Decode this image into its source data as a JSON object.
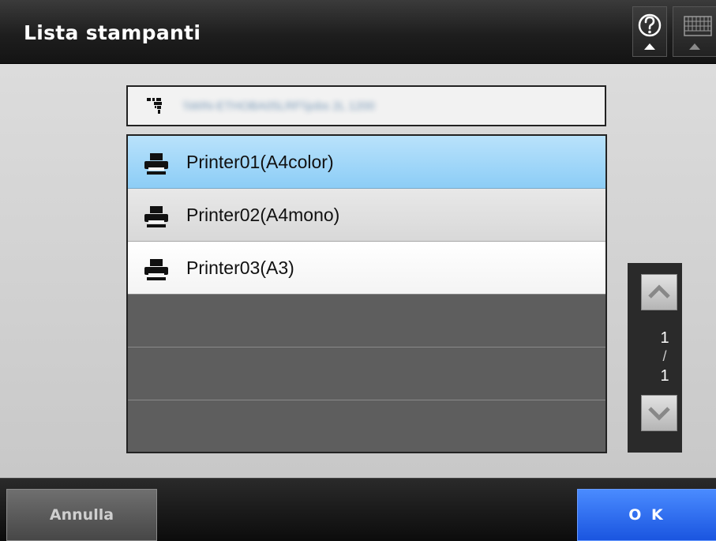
{
  "header": {
    "title": "Lista stampanti",
    "help_icon": "help-icon",
    "keyboard_icon": "keyboard-icon"
  },
  "device": {
    "icon": "network-device-icon",
    "name": "\\\\WIN-ETHOBA05LRF\\\\jobs 2L 1200"
  },
  "printers": [
    {
      "label": "Printer01(A4color)",
      "state": "selected",
      "icon": "printer-icon"
    },
    {
      "label": "Printer02(A4mono)",
      "state": "alt",
      "icon": "printer-icon"
    },
    {
      "label": "Printer03(A3)",
      "state": "plain",
      "icon": "printer-icon"
    }
  ],
  "pager": {
    "current": "1",
    "separator": "/",
    "total": "1"
  },
  "footer": {
    "cancel_label": "Annulla",
    "ok_label": "O K"
  },
  "colors": {
    "selected_row": "#a6d8f9",
    "ok_button": "#2f6ff0",
    "header_bg": "#222222"
  }
}
